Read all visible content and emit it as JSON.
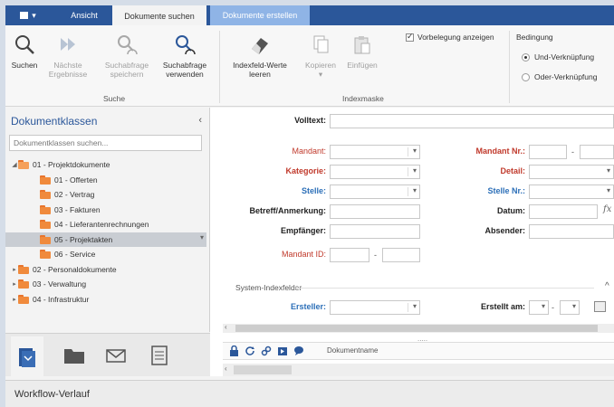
{
  "colors": {
    "accent": "#2b579a",
    "context_tab": "#8fb4e6",
    "required_label": "#c0392b",
    "index_label": "#2c6fb8",
    "folder": "#f08a3c"
  },
  "tabs": {
    "app_menu": "",
    "ansicht": "Ansicht",
    "dokumente_suchen": "Dokumente suchen",
    "dokumente_erstellen": "Dokumente erstellen"
  },
  "ribbon": {
    "suchen": "Suchen",
    "naechste_ergebnisse_1": "Nächste",
    "naechste_ergebnisse_2": "Ergebnisse",
    "suchabfrage_speichern_1": "Suchabfrage",
    "suchabfrage_speichern_2": "speichern",
    "suchabfrage_verwenden_1": "Suchabfrage",
    "suchabfrage_verwenden_2": "verwenden",
    "group_suche": "Suche",
    "indexfeld_1": "Indexfeld-Werte",
    "indexfeld_2": "leeren",
    "kopieren": "Kopieren",
    "einfuegen": "Einfügen",
    "group_indexmaske": "Indexmaske",
    "vorbelegung": "Vorbelegung anzeigen",
    "bedingung": "Bedingung",
    "und": "Und-Verknüpfung",
    "oder": "Oder-Verknüpfung"
  },
  "left": {
    "title": "Dokumentklassen",
    "collapse": "‹",
    "search_placeholder": "Dokumentklassen suchen...",
    "tree": [
      {
        "label": "01 - Projektdokumente",
        "expander": "◢"
      },
      {
        "label": "01 - Offerten"
      },
      {
        "label": "02 - Vertrag"
      },
      {
        "label": "03 - Fakturen"
      },
      {
        "label": "04 - Lieferantenrechnungen"
      },
      {
        "label": "05 - Projektakten"
      },
      {
        "label": "06 - Service"
      },
      {
        "label": "02 - Personaldokumente",
        "expander": "▸"
      },
      {
        "label": "03 - Verwaltung",
        "expander": "▸"
      },
      {
        "label": "04 - Infrastruktur",
        "expander": "▸"
      }
    ]
  },
  "form": {
    "volltext": "Volltext:",
    "mandant": "Mandant:",
    "mandant_nr": "Mandant Nr.:",
    "kategorie": "Kategorie:",
    "detail": "Detail:",
    "stelle": "Stelle:",
    "stelle_nr": "Stelle Nr.:",
    "betreff": "Betreff/Anmerkung:",
    "datum": "Datum:",
    "empfaenger": "Empfänger:",
    "absender": "Absender:",
    "mandant_id": "Mandant ID:",
    "dash": "-",
    "fx": "fx",
    "system_indexfelder": "System-Indexfelder",
    "ersteller": "Ersteller:",
    "erstellt_am": "Erstellt am:",
    "fieldset_toggle": "^"
  },
  "results": {
    "column": "Dokumentname",
    "dots": "....."
  },
  "workflow": "Workflow-Verlauf"
}
